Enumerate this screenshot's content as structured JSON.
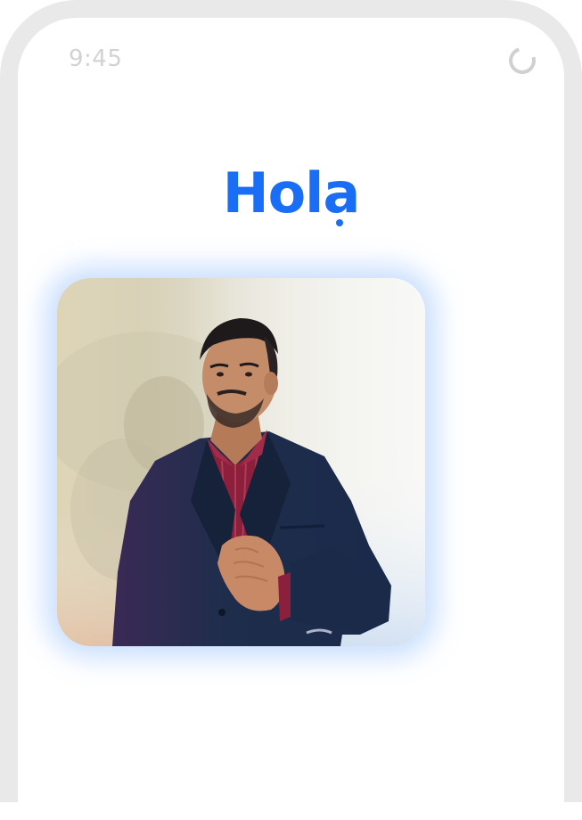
{
  "status_bar": {
    "time": "9:45",
    "indicator_icon": "loading-ring-icon"
  },
  "main": {
    "greeting_text": "Hola",
    "photo_icon": "portrait-photo"
  },
  "colors": {
    "accent": "#1a6ef5",
    "frame": "#e9e9e9",
    "status_text": "#d2d2d2",
    "jacket": "#1f2d4c",
    "shirt": "#8b1f3c"
  }
}
